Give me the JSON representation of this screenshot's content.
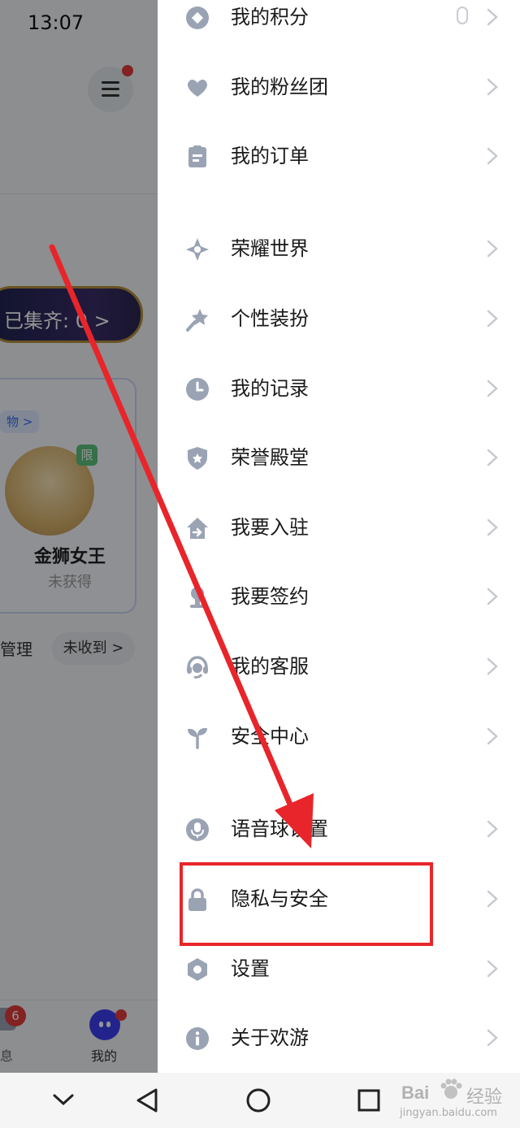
{
  "status_bar": {
    "time": "13:07"
  },
  "background_app": {
    "collect_text": "已集齐: 0 >",
    "gift_tag": "物 >",
    "limit_badge": "限",
    "card_name": "金狮女王",
    "card_status": "未获得",
    "manage_label": "管理",
    "not_received_label": "未收到 >",
    "nav": {
      "messages_badge": "6",
      "messages_label": "息",
      "me_label": "我的"
    }
  },
  "drawer": {
    "items": [
      {
        "label": "我的积分",
        "icon": "points-icon"
      },
      {
        "label": "我的粉丝团",
        "icon": "fan-club-icon"
      },
      {
        "label": "我的订单",
        "icon": "order-icon"
      },
      {
        "label": "荣耀世界",
        "icon": "honor-world-icon"
      },
      {
        "label": "个性装扮",
        "icon": "dress-up-icon"
      },
      {
        "label": "我的记录",
        "icon": "record-clock-icon"
      },
      {
        "label": "荣誉殿堂",
        "icon": "honor-shield-icon"
      },
      {
        "label": "我要入驻",
        "icon": "join-house-icon"
      },
      {
        "label": "我要签约",
        "icon": "sign-contract-icon"
      },
      {
        "label": "我的客服",
        "icon": "customer-service-icon"
      },
      {
        "label": "安全中心",
        "icon": "security-sprout-icon"
      },
      {
        "label": "语音球设置",
        "icon": "microphone-icon"
      },
      {
        "label": "隐私与安全",
        "icon": "lock-icon"
      },
      {
        "label": "设置",
        "icon": "settings-hex-icon"
      },
      {
        "label": "关于欢游",
        "icon": "info-icon"
      }
    ]
  },
  "watermark": {
    "brand": "Bai",
    "brand_cn": "经验",
    "url": "jingyan.baidu.com"
  },
  "colors": {
    "icon_gray": "#9aa3b3",
    "annotation_red": "#e8252a",
    "accent_blue": "#3b3ff2"
  }
}
